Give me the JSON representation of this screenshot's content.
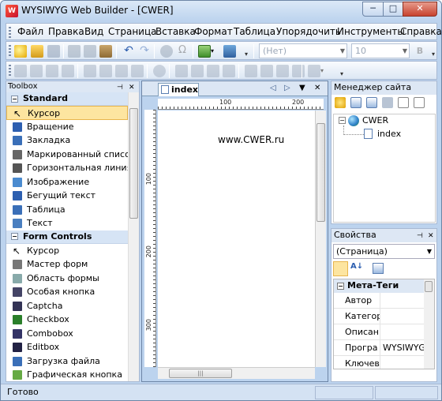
{
  "window": {
    "title": "WYSIWYG Web Builder - [CWER]",
    "icon": "web-builder-app-icon",
    "controls": {
      "minimize": "─",
      "maximize": "□",
      "close": "✕"
    }
  },
  "menu": [
    "Файл",
    "Правка",
    "Вид",
    "Страница",
    "Вставка",
    "Формат",
    "Таблица",
    "Упорядочить",
    "Инструменты",
    "Справка"
  ],
  "toolbar": {
    "style_combo": "(Нет)",
    "size_combo": "10"
  },
  "toolbox": {
    "title": "Toolbox",
    "categories": [
      {
        "name": "Standard",
        "items": [
          {
            "label": "Курсор",
            "icon": "cursor-icon",
            "selected": true
          },
          {
            "label": "Вращение",
            "icon": "rotate-icon"
          },
          {
            "label": "Закладка",
            "icon": "bookmark-icon"
          },
          {
            "label": "Маркированный список",
            "icon": "bullet-list-icon"
          },
          {
            "label": "Горизонтальная линия",
            "icon": "horizontal-line-icon"
          },
          {
            "label": "Изображение",
            "icon": "image-icon"
          },
          {
            "label": "Бегущий текст",
            "icon": "marquee-icon"
          },
          {
            "label": "Таблица",
            "icon": "table-icon"
          },
          {
            "label": "Текст",
            "icon": "text-icon"
          }
        ]
      },
      {
        "name": "Form Controls",
        "items": [
          {
            "label": "Курсор",
            "icon": "cursor-icon"
          },
          {
            "label": "Мастер форм",
            "icon": "form-wizard-icon"
          },
          {
            "label": "Область формы",
            "icon": "form-area-icon"
          },
          {
            "label": "Особая кнопка",
            "icon": "advanced-button-icon"
          },
          {
            "label": "Captcha",
            "icon": "captcha-icon"
          },
          {
            "label": "Checkbox",
            "icon": "checkbox-icon"
          },
          {
            "label": "Combobox",
            "icon": "combobox-icon"
          },
          {
            "label": "Editbox",
            "icon": "editbox-icon"
          },
          {
            "label": "Загрузка файла",
            "icon": "file-upload-icon"
          },
          {
            "label": "Графическая кнопка",
            "icon": "image-button-icon"
          }
        ]
      }
    ]
  },
  "document": {
    "tab": "index",
    "ruler_top": [
      "100",
      "200"
    ],
    "ruler_left": [
      "100",
      "200",
      "300"
    ],
    "content_text": "www.CWER.ru"
  },
  "site_manager": {
    "title": "Менеджер сайта",
    "tree": [
      {
        "label": "CWER",
        "icon": "globe-icon",
        "expand": "−"
      },
      {
        "label": "index",
        "icon": "page-icon"
      }
    ]
  },
  "properties": {
    "title": "Свойства",
    "selector": "(Страница)",
    "category": "Мета-Теги",
    "rows": [
      {
        "name": "Автор",
        "value": ""
      },
      {
        "name": "Категор",
        "value": ""
      },
      {
        "name": "Описан",
        "value": ""
      },
      {
        "name": "Програ",
        "value": "WYSIWYG V"
      },
      {
        "name": "Ключев",
        "value": ""
      }
    ]
  },
  "status": {
    "text": "Готово"
  },
  "colors": {
    "frame": "#bcd3ee",
    "selection": "#fde5a0",
    "category": "#d6e4f5"
  }
}
